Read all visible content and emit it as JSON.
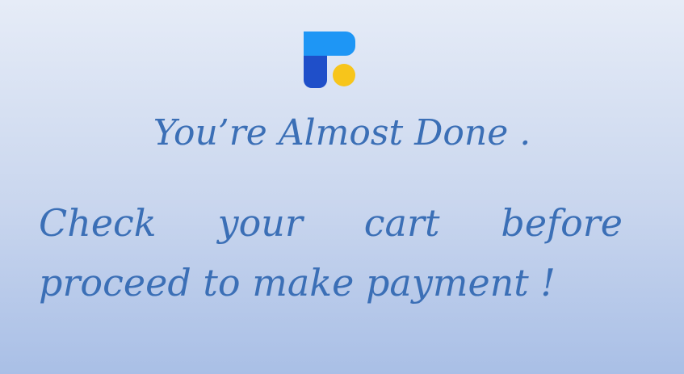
{
  "headline": "You’re Almost Done .",
  "message": {
    "words_line1": [
      "Check",
      "your",
      "cart",
      "before"
    ],
    "line2": "proceed to make payment !"
  },
  "colors": {
    "text": "#3b6fb6",
    "logo_blue_dark": "#1f4fc9",
    "logo_blue_light": "#1e96f5",
    "logo_yellow": "#f7c51b"
  }
}
